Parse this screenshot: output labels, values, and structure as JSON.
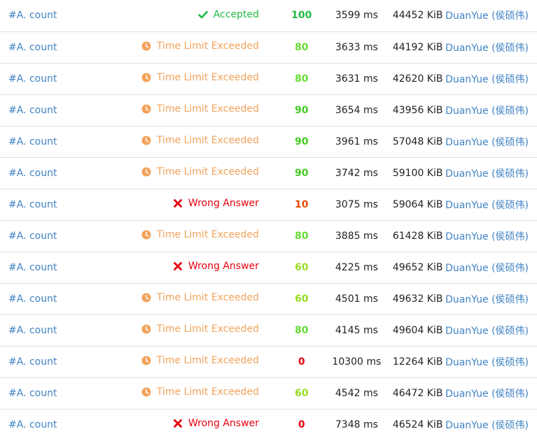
{
  "colors": {
    "accepted": "#21ba45",
    "tle": "#f2a35b",
    "wrong": "#e8000e",
    "link": "#4183c4",
    "row_border": "#e0e0e0"
  },
  "submissions": [
    {
      "problem": "#A. count",
      "status": "Accepted",
      "status_type": "accepted",
      "status_icon": "check-icon",
      "score": "100",
      "score_color": "#21ba45",
      "time": "3599 ms",
      "memory": "44452 KiB",
      "user": "DuanYue (侯硕伟)"
    },
    {
      "problem": "#A. count",
      "status": "Time Limit Exceeded",
      "status_type": "tle",
      "status_icon": "clock-icon",
      "score": "80",
      "score_color": "#66dd33",
      "time": "3633 ms",
      "memory": "44192 KiB",
      "user": "DuanYue (侯硕伟)"
    },
    {
      "problem": "#A. count",
      "status": "Time Limit Exceeded",
      "status_type": "tle",
      "status_icon": "clock-icon",
      "score": "80",
      "score_color": "#66dd33",
      "time": "3631 ms",
      "memory": "42620 KiB",
      "user": "DuanYue (侯硕伟)"
    },
    {
      "problem": "#A. count",
      "status": "Time Limit Exceeded",
      "status_type": "tle",
      "status_icon": "clock-icon",
      "score": "90",
      "score_color": "#44cc22",
      "time": "3654 ms",
      "memory": "43956 KiB",
      "user": "DuanYue (侯硕伟)"
    },
    {
      "problem": "#A. count",
      "status": "Time Limit Exceeded",
      "status_type": "tle",
      "status_icon": "clock-icon",
      "score": "90",
      "score_color": "#44cc22",
      "time": "3961 ms",
      "memory": "57048 KiB",
      "user": "DuanYue (侯硕伟)"
    },
    {
      "problem": "#A. count",
      "status": "Time Limit Exceeded",
      "status_type": "tle",
      "status_icon": "clock-icon",
      "score": "90",
      "score_color": "#44cc22",
      "time": "3742 ms",
      "memory": "59100 KiB",
      "user": "DuanYue (侯硕伟)"
    },
    {
      "problem": "#A. count",
      "status": "Wrong Answer",
      "status_type": "wrong",
      "status_icon": "cross-icon",
      "score": "10",
      "score_color": "#f04b00",
      "time": "3075 ms",
      "memory": "59064 KiB",
      "user": "DuanYue (侯硕伟)"
    },
    {
      "problem": "#A. count",
      "status": "Time Limit Exceeded",
      "status_type": "tle",
      "status_icon": "clock-icon",
      "score": "80",
      "score_color": "#66dd33",
      "time": "3885 ms",
      "memory": "61428 KiB",
      "user": "DuanYue (侯硕伟)"
    },
    {
      "problem": "#A. count",
      "status": "Wrong Answer",
      "status_type": "wrong",
      "status_icon": "cross-icon",
      "score": "60",
      "score_color": "#99dd22",
      "time": "4225 ms",
      "memory": "49652 KiB",
      "user": "DuanYue (侯硕伟)"
    },
    {
      "problem": "#A. count",
      "status": "Time Limit Exceeded",
      "status_type": "tle",
      "status_icon": "clock-icon",
      "score": "60",
      "score_color": "#99dd22",
      "time": "4501 ms",
      "memory": "49632 KiB",
      "user": "DuanYue (侯硕伟)"
    },
    {
      "problem": "#A. count",
      "status": "Time Limit Exceeded",
      "status_type": "tle",
      "status_icon": "clock-icon",
      "score": "80",
      "score_color": "#66dd33",
      "time": "4145 ms",
      "memory": "49604 KiB",
      "user": "DuanYue (侯硕伟)"
    },
    {
      "problem": "#A. count",
      "status": "Time Limit Exceeded",
      "status_type": "tle",
      "status_icon": "clock-icon",
      "score": "0",
      "score_color": "#e8000e",
      "time": "10300 ms",
      "memory": "12264 KiB",
      "user": "DuanYue (侯硕伟)"
    },
    {
      "problem": "#A. count",
      "status": "Time Limit Exceeded",
      "status_type": "tle",
      "status_icon": "clock-icon",
      "score": "60",
      "score_color": "#99dd22",
      "time": "4542 ms",
      "memory": "46472 KiB",
      "user": "DuanYue (侯硕伟)"
    },
    {
      "problem": "#A. count",
      "status": "Wrong Answer",
      "status_type": "wrong",
      "status_icon": "cross-icon",
      "score": "0",
      "score_color": "#e8000e",
      "time": "7348 ms",
      "memory": "46524 KiB",
      "user": "DuanYue (侯硕伟)"
    }
  ]
}
